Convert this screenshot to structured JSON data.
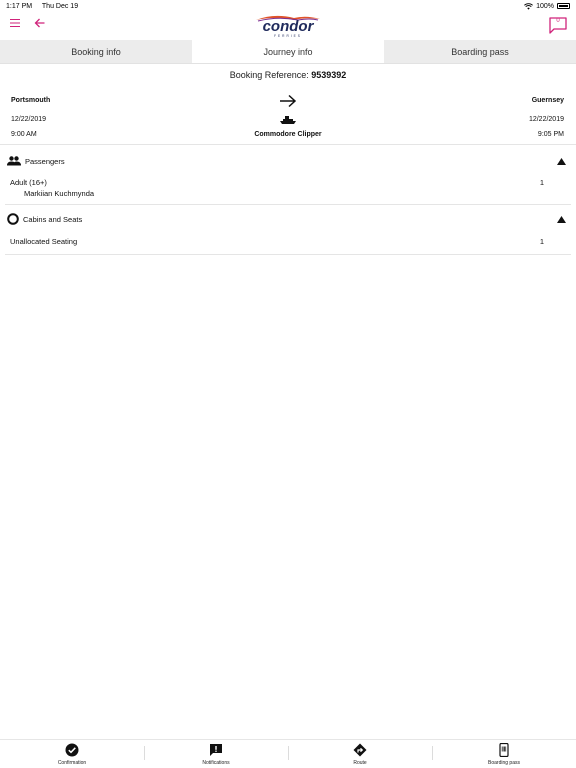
{
  "status_bar": {
    "time": "1:17 PM",
    "date": "Thu Dec 19",
    "battery": "100%"
  },
  "header": {
    "notification_count": "0",
    "brand": {
      "name": "condor",
      "tagline": "FERRIES"
    }
  },
  "tabs": [
    {
      "label": "Booking info",
      "active": false
    },
    {
      "label": "Journey info",
      "active": true
    },
    {
      "label": "Boarding pass",
      "active": false
    }
  ],
  "booking": {
    "ref_label": "Booking Reference:",
    "ref_value": "9539392"
  },
  "journey": {
    "origin": "Portsmouth",
    "destination": "Guernsey",
    "depart_date": "12/22/2019",
    "arrive_date": "12/22/2019",
    "depart_time": "9:00 AM",
    "arrive_time": "9:05 PM",
    "vessel": "Commodore Clipper"
  },
  "passengers": {
    "title": "Passengers",
    "rows": [
      {
        "label": "Adult (16+)",
        "count": "1",
        "name": "Markiian Kuchmynda"
      }
    ]
  },
  "cabins": {
    "title": "Cabins and Seats",
    "rows": [
      {
        "label": "Unallocated Seating",
        "count": "1"
      }
    ]
  },
  "bottom_nav": [
    {
      "label": "Confirmation",
      "icon": "check-circle-icon"
    },
    {
      "label": "Notifications",
      "icon": "alert-message-icon"
    },
    {
      "label": "Route",
      "icon": "route-sign-icon"
    },
    {
      "label": "Boarding pass",
      "icon": "phone-barcode-icon"
    }
  ],
  "colors": {
    "accent": "#d0237b",
    "brand_navy": "#1f2a5c",
    "tab_inactive": "#ececec"
  }
}
